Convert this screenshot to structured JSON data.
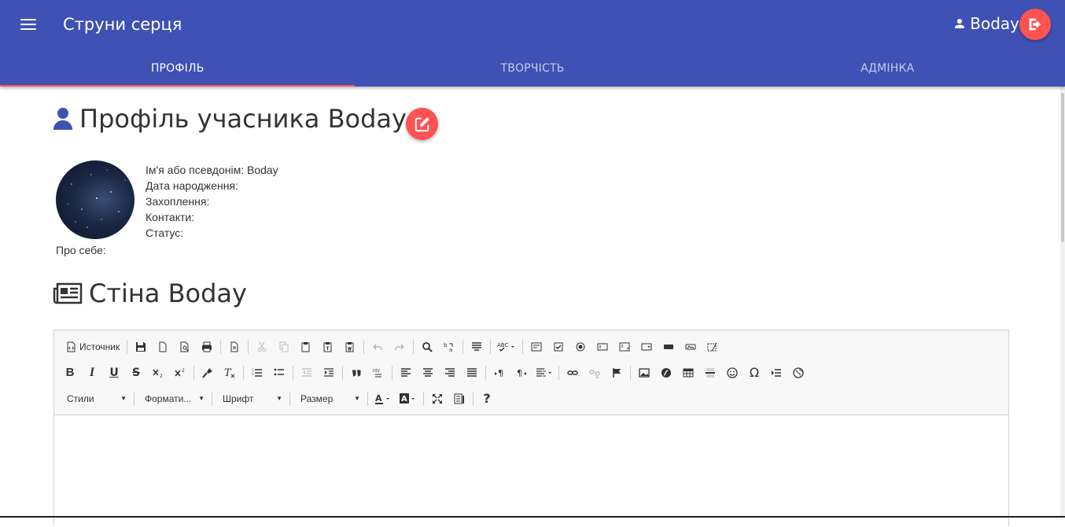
{
  "header": {
    "app_title": "Струни серця",
    "username": "Boday"
  },
  "tabs": [
    {
      "label": "ПРОФІЛЬ",
      "active": true
    },
    {
      "label": "ТВОРЧІСТЬ",
      "active": false
    },
    {
      "label": "АДМІНКА",
      "active": false
    }
  ],
  "profile": {
    "title": "Профіль учасника Boday",
    "fields": {
      "name": "Ім'я або псевдонім: Boday",
      "birthday": "Дата народження:",
      "hobbies": "Захоплення:",
      "contacts": "Контакти:",
      "status": "Статус:"
    },
    "about": "Про себе:"
  },
  "wall": {
    "title": "Стіна Boday"
  },
  "editor": {
    "source_label": "Источник",
    "combos": {
      "styles": "Стили",
      "format": "Формати...",
      "font": "Шрифт",
      "size": "Размер"
    }
  },
  "colors": {
    "primary": "#3f51b5",
    "accent": "#ff5252"
  }
}
